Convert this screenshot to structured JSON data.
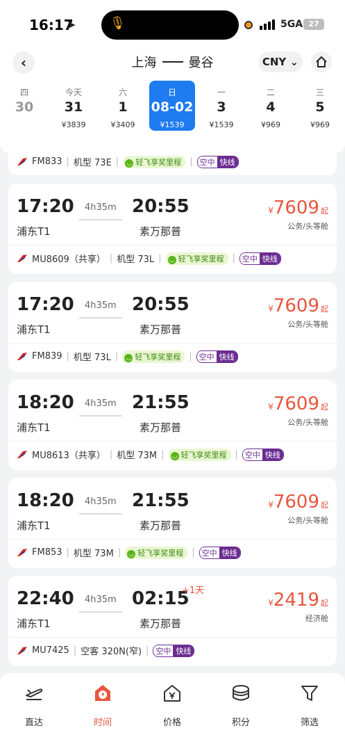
{
  "status": {
    "time": "16:17",
    "network": "5GA",
    "battery": "27"
  },
  "header": {
    "origin": "上海",
    "destination": "曼谷",
    "currency": "CNY",
    "back_glyph": "‹",
    "currency_caret": "⌄",
    "expand_glyph": "⌄"
  },
  "dates": [
    {
      "weekday": "四",
      "day": "30",
      "price": ""
    },
    {
      "weekday": "今天",
      "day": "31",
      "price": "¥3839"
    },
    {
      "weekday": "六",
      "day": "1",
      "price": "¥3409"
    },
    {
      "weekday": "日",
      "day": "08-02",
      "price": "¥1539"
    },
    {
      "weekday": "一",
      "day": "3",
      "price": "¥1539"
    },
    {
      "weekday": "二",
      "day": "4",
      "price": "¥969"
    },
    {
      "weekday": "三",
      "day": "5",
      "price": "¥969"
    }
  ],
  "partial_flight": {
    "flight": "FM833",
    "aircraft": "机型 73E",
    "green_tag": "轻飞享奖里程",
    "tag_a": "空中",
    "tag_b": "快线"
  },
  "flights": [
    {
      "dep": "17:20",
      "arr": "20:55",
      "dur": "4h35m",
      "dep_ap": "浦东T1",
      "arr_ap": "素万那普",
      "plus": "",
      "currency": "¥",
      "price": "7609",
      "qi": "起",
      "cabin": "公务/头等舱",
      "flight": "MU8609（共享）",
      "aircraft": "机型 73L",
      "green_tag": "轻飞享奖里程",
      "tag_a": "空中",
      "tag_b": "快线"
    },
    {
      "dep": "17:20",
      "arr": "20:55",
      "dur": "4h35m",
      "dep_ap": "浦东T1",
      "arr_ap": "素万那普",
      "plus": "",
      "currency": "¥",
      "price": "7609",
      "qi": "起",
      "cabin": "公务/头等舱",
      "flight": "FM839",
      "aircraft": "机型 73L",
      "green_tag": "轻飞享奖里程",
      "tag_a": "空中",
      "tag_b": "快线"
    },
    {
      "dep": "18:20",
      "arr": "21:55",
      "dur": "4h35m",
      "dep_ap": "浦东T1",
      "arr_ap": "素万那普",
      "plus": "",
      "currency": "¥",
      "price": "7609",
      "qi": "起",
      "cabin": "公务/头等舱",
      "flight": "MU8613（共享）",
      "aircraft": "机型 73M",
      "green_tag": "轻飞享奖里程",
      "tag_a": "空中",
      "tag_b": "快线"
    },
    {
      "dep": "18:20",
      "arr": "21:55",
      "dur": "4h35m",
      "dep_ap": "浦东T1",
      "arr_ap": "素万那普",
      "plus": "",
      "currency": "¥",
      "price": "7609",
      "qi": "起",
      "cabin": "公务/头等舱",
      "flight": "FM853",
      "aircraft": "机型 73M",
      "green_tag": "轻飞享奖里程",
      "tag_a": "空中",
      "tag_b": "快线"
    },
    {
      "dep": "22:40",
      "arr": "02:15",
      "dur": "4h35m",
      "dep_ap": "浦东T1",
      "arr_ap": "素万那普",
      "plus": "+1天",
      "currency": "¥",
      "price": "2419",
      "qi": "起",
      "cabin": "经济舱",
      "flight": "MU7425",
      "aircraft": "空客 320N(窄)",
      "green_tag": "",
      "tag_a": "空中",
      "tag_b": "快线"
    }
  ],
  "tabs": [
    {
      "label": "直达",
      "icon": "direct-flight-icon"
    },
    {
      "label": "时间",
      "icon": "clock-icon"
    },
    {
      "label": "价格",
      "icon": "price-icon"
    },
    {
      "label": "积分",
      "icon": "points-icon"
    },
    {
      "label": "筛选",
      "icon": "filter-icon"
    }
  ],
  "colors": {
    "accent": "#1e7bf0",
    "price": "#e8553e",
    "purple": "#6b2c91",
    "green": "#5bb318"
  }
}
